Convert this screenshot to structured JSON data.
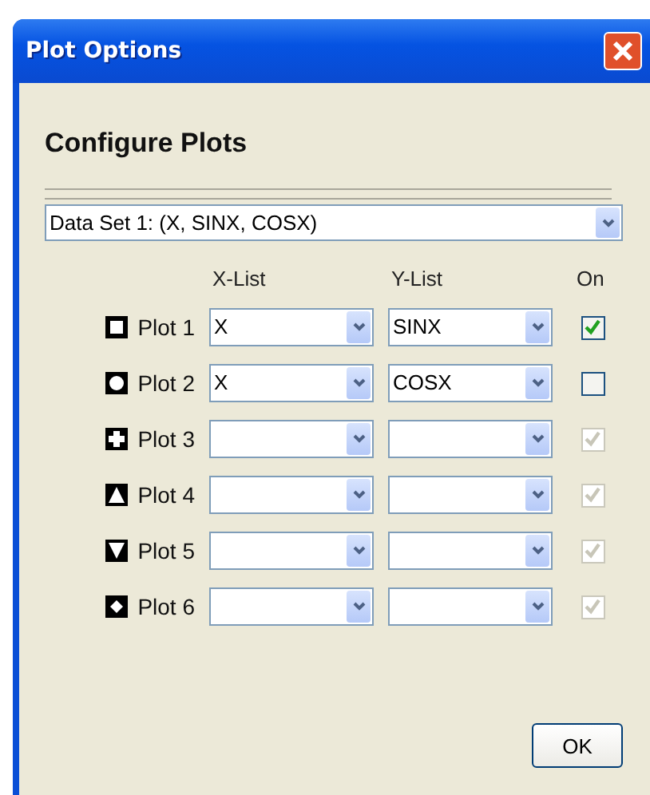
{
  "window": {
    "title": "Plot Options"
  },
  "heading": "Configure Plots",
  "data_set": {
    "value": "Data Set 1: (X, SINX, COSX)"
  },
  "columns": [
    "X-List",
    "Y-List",
    "On"
  ],
  "plots": [
    {
      "label": "Plot 1",
      "kind": "square",
      "x_list": "X",
      "y_list": "SINX",
      "checked": true,
      "disabled": false
    },
    {
      "label": "Plot 2",
      "kind": "circle",
      "x_list": "X",
      "y_list": "COSX",
      "checked": false,
      "disabled": false
    },
    {
      "label": "Plot 3",
      "kind": "plus",
      "checked": true,
      "disabled": true
    },
    {
      "label": "Plot 4",
      "kind": "triangle",
      "checked": true,
      "disabled": true
    },
    {
      "label": "Plot 5",
      "kind": "inverted-triangle",
      "checked": true,
      "disabled": true
    },
    {
      "label": "Plot 6",
      "kind": "diamond",
      "checked": true,
      "disabled": true
    }
  ],
  "buttons": [
    "OK"
  ]
}
